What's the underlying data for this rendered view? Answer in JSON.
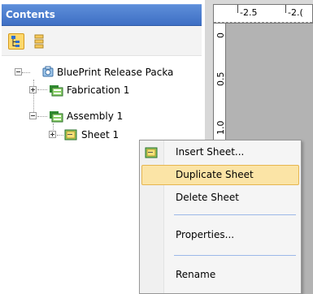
{
  "contents_pane": {
    "title": "Contents",
    "toolbar": {
      "tree_view_icon": "tree-view-icon",
      "list_view_icon": "list-view-icon"
    },
    "tree": {
      "root": {
        "label": "BluePrint Release Packa",
        "icon": "package-icon",
        "expanded": true
      },
      "fabrication": {
        "label": "Fabrication 1",
        "icon": "drawing-set-icon",
        "expanded": false
      },
      "assembly": {
        "label": "Assembly 1",
        "icon": "drawing-set-icon",
        "expanded": true
      },
      "sheet": {
        "label": "Sheet 1",
        "icon": "sheet-icon",
        "expanded": false
      }
    }
  },
  "drawing_area": {
    "ruler_top": {
      "labels": [
        "-2.5",
        "-2.("
      ]
    },
    "ruler_left": {
      "labels": [
        "0",
        "0.5",
        "1.0"
      ]
    }
  },
  "context_menu": {
    "items": [
      {
        "label": "Insert Sheet...",
        "icon": "sheet-icon"
      },
      {
        "label": "Duplicate Sheet",
        "highlighted": true
      },
      {
        "label": "Delete Sheet"
      },
      {
        "label": "Properties..."
      },
      {
        "label": "Rename"
      }
    ]
  },
  "colors": {
    "header_blue": "#3e6fc4",
    "menu_highlight": "#fbe4a6",
    "icon_green": "#3c9a3c"
  }
}
